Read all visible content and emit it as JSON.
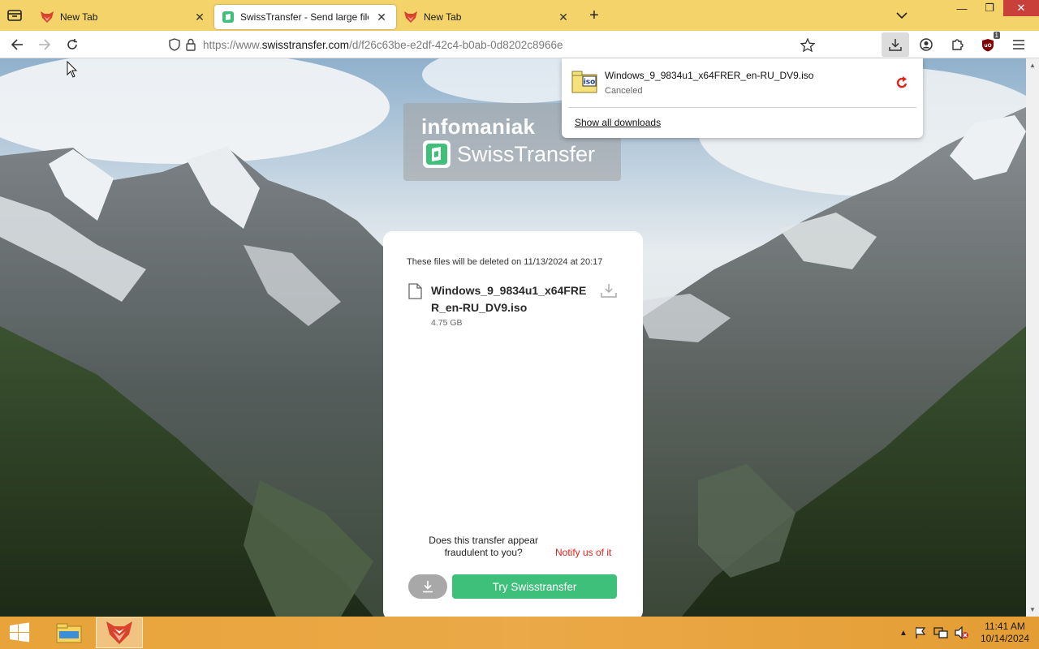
{
  "tabs": [
    {
      "title": "New Tab",
      "active": false
    },
    {
      "title": "SwissTransfer - Send large files",
      "active": true
    },
    {
      "title": "New Tab",
      "active": false
    }
  ],
  "url": {
    "prefix": "https://www.",
    "domain": "swisstransfer.com",
    "path": "/d/f26c63be-e2df-42c4-b0ab-0d8202c8966e"
  },
  "ublock_badge": "1",
  "brand": {
    "company": "infomaniak",
    "product": "SwissTransfer"
  },
  "transfer": {
    "expiry_text": "These files will be deleted on 11/13/2024 at 20:17",
    "file_name": "Windows_9_9834u1_x64FRER_en-RU_DV9.iso",
    "file_size": "4.75 GB",
    "fraud_text": "Does this transfer appear fraudulent to you?",
    "fraud_link": "Notify us of it",
    "try_button": "Try Swisstransfer"
  },
  "downloads_panel": {
    "file_name": "Windows_9_9834u1_x64FRER_en-RU_DV9.iso",
    "status": "Canceled",
    "show_all": "Show all downloads",
    "icon_label": "iso"
  },
  "clock": {
    "time": "11:41 AM",
    "date": "10/14/2024"
  },
  "colors": {
    "tabbar": "#f3d36a",
    "accent_green": "#3ebf7a",
    "link_red": "#e2231a",
    "taskbar": "#eba947"
  }
}
